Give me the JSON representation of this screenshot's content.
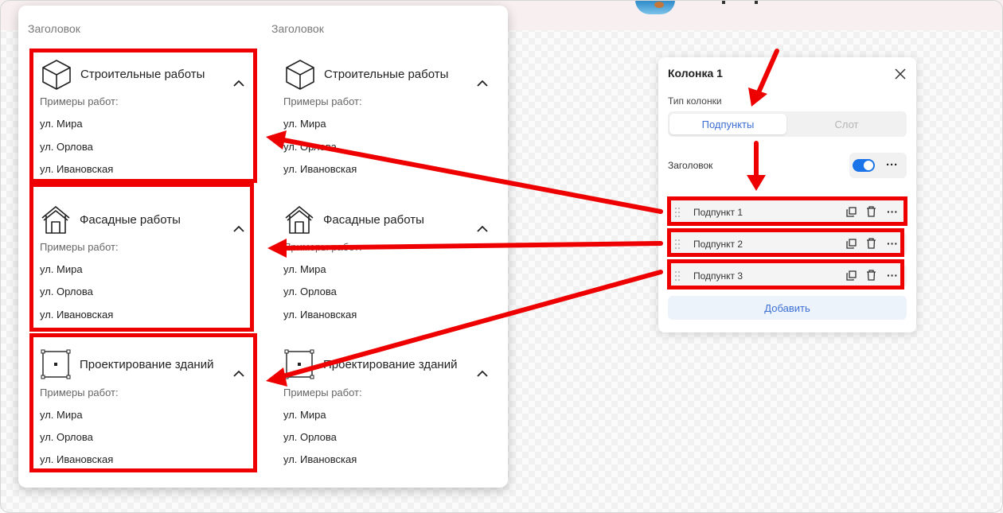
{
  "menu": {
    "columns": [
      {
        "heading": "Заголовок",
        "sections": [
          {
            "title": "Строительные работы",
            "icon": "cube-icon",
            "examples_label": "Примеры работ:",
            "items": [
              "ул. Мира",
              "ул. Орлова",
              "ул. Ивановская"
            ]
          },
          {
            "title": "Фасадные работы",
            "icon": "house-icon",
            "examples_label": "Примеры работ:",
            "items": [
              "ул. Мира",
              "ул. Орлова",
              "ул. Ивановская"
            ]
          },
          {
            "title": "Проектирование зданий",
            "icon": "blueprint-icon",
            "examples_label": "Примеры работ:",
            "items": [
              "ул. Мира",
              "ул. Орлова",
              "ул. Ивановская"
            ]
          }
        ]
      },
      {
        "heading": "Заголовок",
        "sections": [
          {
            "title": "Строительные работы",
            "icon": "cube-icon",
            "examples_label": "Примеры работ:",
            "items": [
              "ул. Мира",
              "ул. Орлова",
              "ул. Ивановская"
            ]
          },
          {
            "title": "Фасадные работы",
            "icon": "house-icon",
            "examples_label": "Примеры работ:",
            "items": [
              "ул. Мира",
              "ул. Орлова",
              "ул. Ивановская"
            ]
          },
          {
            "title": "Проектирование зданий",
            "icon": "blueprint-icon",
            "examples_label": "Примеры работ:",
            "items": [
              "ул. Мира",
              "ул. Орлова",
              "ул. Ивановская"
            ]
          }
        ]
      }
    ]
  },
  "panel": {
    "title": "Колонка 1",
    "column_type_label": "Тип колонки",
    "segment": {
      "active": "Подпункты",
      "inactive": "Слот"
    },
    "header_toggle": {
      "label": "Заголовок",
      "on": true
    },
    "more_label": "···",
    "subitems": [
      "Подпункт 1",
      "Подпункт 2",
      "Подпункт 3"
    ],
    "add_label": "Добавить"
  },
  "colors": {
    "accent": "#1a73e8",
    "annotation": "#ee0000"
  }
}
